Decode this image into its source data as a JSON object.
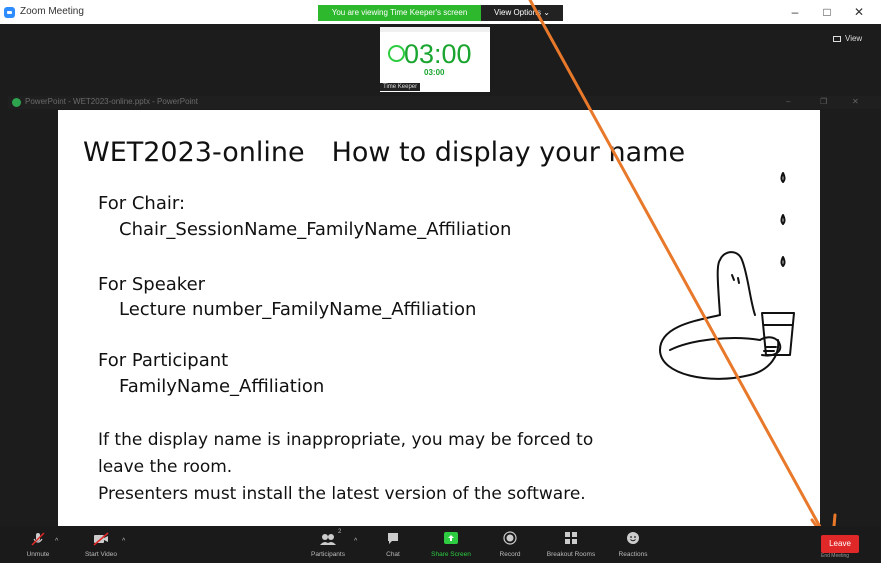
{
  "window": {
    "title": "Zoom Meeting",
    "banner": "You are viewing Time Keeper's screen",
    "view_options": "View Options ⌄",
    "minimize": "–",
    "maximize": "□",
    "close": "✕"
  },
  "meeting": {
    "view_label": "View",
    "thumbnail": {
      "time": "03:00",
      "time_small": "03:00",
      "name": "Time Keeper"
    }
  },
  "ppt": {
    "title": "PowerPoint - WET2023-online.pptx - PowerPoint"
  },
  "slide": {
    "title": "WET2023-online　How to display your name",
    "chair_head": "For Chair:",
    "chair_format": "Chair_SessionName_FamilyName_Affiliation",
    "speaker_head": "For Speaker",
    "speaker_format": "Lecture number_FamilyName_Affiliation",
    "participant_head": "For Participant",
    "participant_format": "FamilyName_Affiliation",
    "warning_line1": "If the display name is inappropriate, you may be forced to",
    "warning_line2": "leave the room.",
    "warning_line3": "Presenters must install the latest version of the software."
  },
  "toolbar": {
    "unmute": "Unmute",
    "start_video": "Start Video",
    "participants": "Participants",
    "participants_count": "2",
    "chat": "Chat",
    "share_screen": "Share Screen",
    "record": "Record",
    "breakout_rooms": "Breakout Rooms",
    "reactions": "Reactions",
    "leave": "Leave",
    "leave_sub": "End Meeting"
  },
  "colors": {
    "banner_green": "#2eb82e",
    "leave_red": "#e02828",
    "share_green": "#2ecc40",
    "annotation_orange": "#e8782a"
  }
}
